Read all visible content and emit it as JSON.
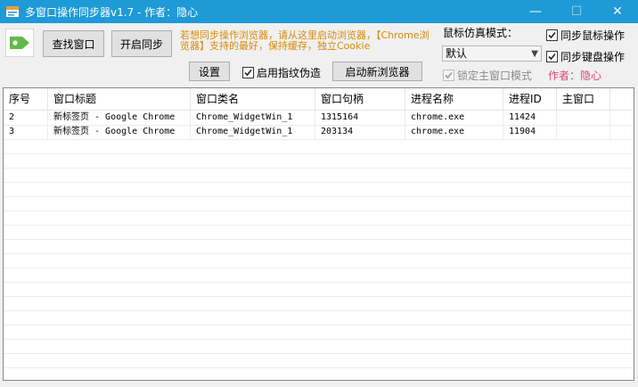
{
  "window": {
    "title": "多窗口操作同步器v1.7 - 作者：隐心"
  },
  "titlebar": {
    "minimize": "—",
    "maximize": "☐",
    "close": "✕"
  },
  "toolbar": {
    "find_window": "查找窗口",
    "start_sync": "开启同步",
    "settings": "设置",
    "launch_browser": "启动新浏览器",
    "notice": "若想同步操作浏览器，请从这里启动浏览器，【Chrome浏览器】支持的最好，保持缓存，独立Cookie",
    "fingerprint_checkbox": {
      "label": "启用指纹伪造",
      "checked": true
    }
  },
  "mouse_mode": {
    "label": "鼠标仿真模式：",
    "selected": "默认",
    "lock_main": {
      "label": "锁定主窗口模式",
      "checked": true,
      "disabled": true
    }
  },
  "sync_options": {
    "mouse": {
      "label": "同步鼠标操作",
      "checked": true
    },
    "keyboard": {
      "label": "同步键盘操作",
      "checked": true
    }
  },
  "author": {
    "label": "作者：隐心",
    "color": "#e0457b"
  },
  "table": {
    "columns": [
      "序号",
      "窗口标题",
      "窗口类名",
      "窗口句柄",
      "进程名称",
      "进程ID",
      "主窗口"
    ],
    "rows": [
      [
        "2",
        "新标签页 - Google Chrome",
        "Chrome_WidgetWin_1",
        "1315164",
        "chrome.exe",
        "11424",
        ""
      ],
      [
        "3",
        "新标签页 - Google Chrome",
        "Chrome_WidgetWin_1",
        "203134",
        "chrome.exe",
        "11904",
        ""
      ]
    ]
  },
  "colors": {
    "titlebar": "#1e9ad6",
    "notice": "#d88a0a",
    "author": "#e0457b",
    "logo": "#63b84a"
  }
}
